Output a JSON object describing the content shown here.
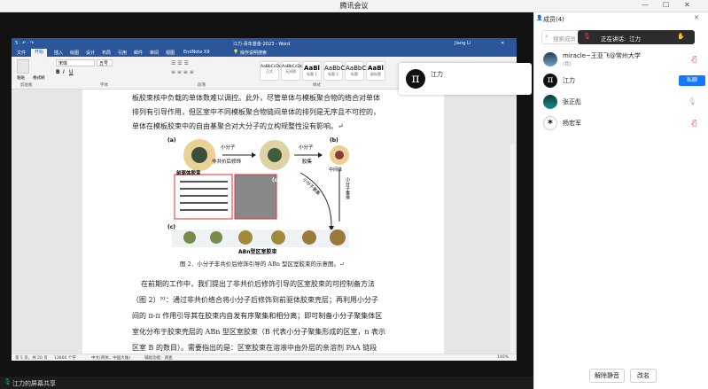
{
  "app": {
    "title": "腾讯会议",
    "share_status": "江力的屏幕共享"
  },
  "word": {
    "quick_access": "5 · ↶ · ↷",
    "doc_title": "江力-青年基金-2023 - Word",
    "user": "Jiang Li",
    "tabs": [
      "文件",
      "开始",
      "插入",
      "绘图",
      "设计",
      "布局",
      "引用",
      "邮件",
      "审阅",
      "视图",
      "EndNote X9"
    ],
    "active_tab": "开始",
    "tell_me": "操作说明搜索",
    "font_name": "宋体",
    "font_size": "五号",
    "groups": {
      "clipboard": "剪贴板",
      "font": "字体",
      "paragraph": "段落",
      "styles": "样式"
    },
    "paste_label": "粘贴",
    "format_painter": "格式刷",
    "styles": [
      {
        "preview": "AaBbCcDc",
        "name": "正文"
      },
      {
        "preview": "AaBbCcDc",
        "name": "无间隔"
      },
      {
        "preview": "AaBl",
        "name": "标题 1"
      },
      {
        "preview": "AaBbC",
        "name": "标题 2"
      },
      {
        "preview": "AaBbC",
        "name": "标题"
      },
      {
        "preview": "AaBl",
        "name": "副标题"
      }
    ],
    "paragraphs_top": [
      "板胶束核中负载的单体数难以调控。此外，尽管单体与模板聚合物的络合对单体",
      "排列有引导作用，但区室中不同模板聚合物链间单体的排列是无序且不可控的，",
      "单体在模板胶束中的自由基聚合对大分子的立构规整性没有影响。↵"
    ],
    "figure": {
      "labels": {
        "a": "(a)",
        "b": "(b)",
        "c": "(c)",
        "d": "(d)"
      },
      "step1_top": "小分子",
      "step1_bottom": "非共价后修饰",
      "step2_top": "小分子",
      "step2_bottom": "胶集",
      "micelle_label": "前驱体胶束",
      "intermediate_label": "中间体",
      "vertical_label": "小分子重排",
      "diag_label": "小分子聚集",
      "bottom_label": "ABn型区室胶束",
      "caption": "图 2．小分子非共价后修饰引导的 ABn 型区室胶束的示意图。↵"
    },
    "paragraphs_bottom": [
      "在前期的工作中，我们提出了非共价后修饰引导的区室胶束的可控制备方法",
      "（图 2）⁹¹：通过非共价络合将小分子后修饰到前驱体胶束壳层；再利用小分子",
      "间的 π-π 作用引导其在胶束内自发有序聚集和相分离；即可制备小分子聚集体区",
      "室化分布于胶束壳层的 ABn 型区室胶束（B 代表小分子聚集形成的区室，n 表示",
      "区室 B 的数目）。需要指出的是：区室胶束在溶液中由外层的亲溶剂 PAA 链段"
    ],
    "status": {
      "page": "第 5 页，共 20 页",
      "words": "13660 个字",
      "lang": "中文(简体，中国大陆)",
      "accessibility": "辅助功能：调查",
      "zoom": "140%"
    }
  },
  "popup": {
    "name": "江力",
    "avatar_glyph": "π"
  },
  "sidebar": {
    "header": "成员(4)",
    "search_placeholder": "搜索成员",
    "speaking_prefix": "正在讲话:",
    "speaking_name": "江力",
    "members": [
      {
        "name": "miracle~王亚飞@常州大学",
        "sub": "(我)",
        "mic": "muted"
      },
      {
        "name": "江力",
        "sub": "",
        "mic": "active",
        "badge": "私聊"
      },
      {
        "name": "张正彪",
        "sub": "",
        "mic": "off"
      },
      {
        "name": "杨宏军",
        "sub": "",
        "mic": "muted"
      }
    ],
    "unmute_all": "解除静音",
    "rename": "改名"
  },
  "colors": {
    "word_blue": "#2b579a",
    "accent_blue": "#1677ff",
    "muted_red": "#e5484d",
    "active_green": "#1aad5c"
  }
}
